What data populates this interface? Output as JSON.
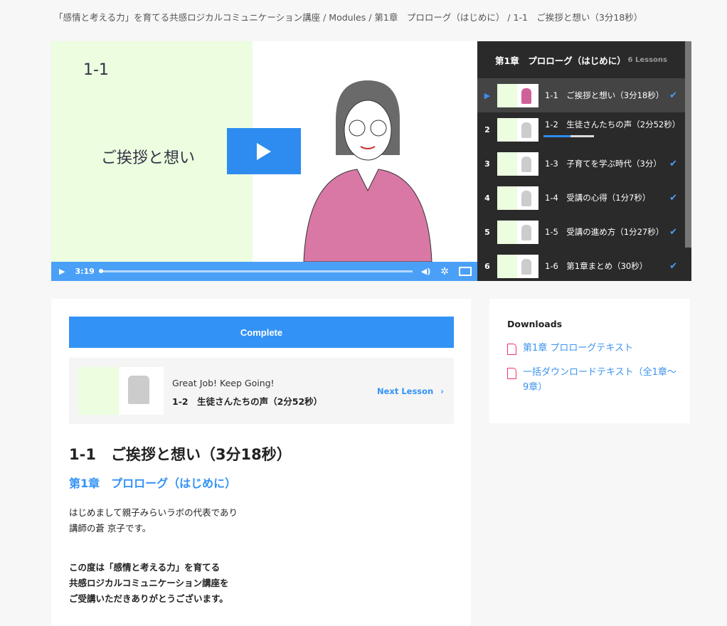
{
  "breadcrumb": "「感情と考える力」を育てる共感ロジカルコミュニケーション講座 / Modules / 第1章　プロローグ（はじめに） / 1-1　ご挨拶と想い（3分18秒）",
  "video": {
    "slide_number": "1-1",
    "slide_title": "ご挨拶と想い",
    "time": "3:19",
    "progress": 0
  },
  "sidebar": {
    "title": "第1章　プロローグ（はじめに）",
    "count": "6 Lessons",
    "items": [
      {
        "num": "▶",
        "title": "1-1　ご挨拶と想い（3分18秒）",
        "done": true
      },
      {
        "num": "2",
        "title": "1-2　生徒さんたちの声（2分52秒）",
        "done": false,
        "progress": 0.53
      },
      {
        "num": "3",
        "title": "1-3　子育てを学ぶ時代（3分）",
        "done": true
      },
      {
        "num": "4",
        "title": "1-4　受講の心得（1分7秒）",
        "done": true
      },
      {
        "num": "5",
        "title": "1-5　受講の進め方（1分27秒）",
        "done": true
      },
      {
        "num": "6",
        "title": "1-6　第1章まとめ（30秒）",
        "done": true
      }
    ]
  },
  "main": {
    "complete": "Complete",
    "next_greeting": "Great Job! Keep Going!",
    "next_title": "1-2　生徒さんたちの声（2分52秒）",
    "next_link": "Next Lesson",
    "title": "1-1　ご挨拶と想い（3分18秒）",
    "subtitle": "第1章　プロローグ（はじめに）",
    "p1a": "はじめまして親子みらいラボの代表であり",
    "p1b": "講師の蒼 京子です。",
    "p2a": "この度は「感情と考える力」を育てる",
    "p2b": "共感ロジカルコミュニケーション講座を",
    "p2c": "ご受講いただきありがとうございます。"
  },
  "downloads": {
    "title": "Downloads",
    "items": [
      "第1章 プロローグテキスト",
      "一括ダウンロードテキスト（全1章〜9章）"
    ]
  }
}
